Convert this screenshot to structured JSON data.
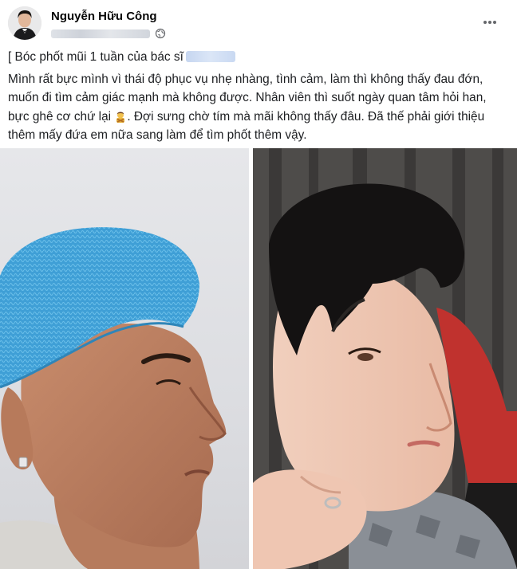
{
  "post": {
    "author": "Nguyễn Hữu Công",
    "title": "[ Bóc phốt mũi 1 tuần của bác sĩ",
    "body_before_emoji": "Mình rất bực mình vì thái độ phục vụ nhẹ nhàng, tình cảm, làm thì không thấy đau đớn, muốn đi tìm cảm giác mạnh mà không được. Nhân viên thì suốt ngày quan tâm hỏi han, bực ghê cơ chứ lại ",
    "body_after_emoji": ". Đợi sưng chờ tím mà mãi không thấy đâu. Đã thế phải giới thiệu thêm mấy đứa em nữa sang làm để tìm phốt thêm vậy.",
    "emoji_icon": "person-gesturing-no-emoji",
    "more_icon": "more-horizontal-icon",
    "privacy_icon": "globe-icon"
  },
  "colors": {
    "text": "#1c1e21",
    "cap": "#3fa0d8",
    "blur_name": "#c6d6f0"
  }
}
